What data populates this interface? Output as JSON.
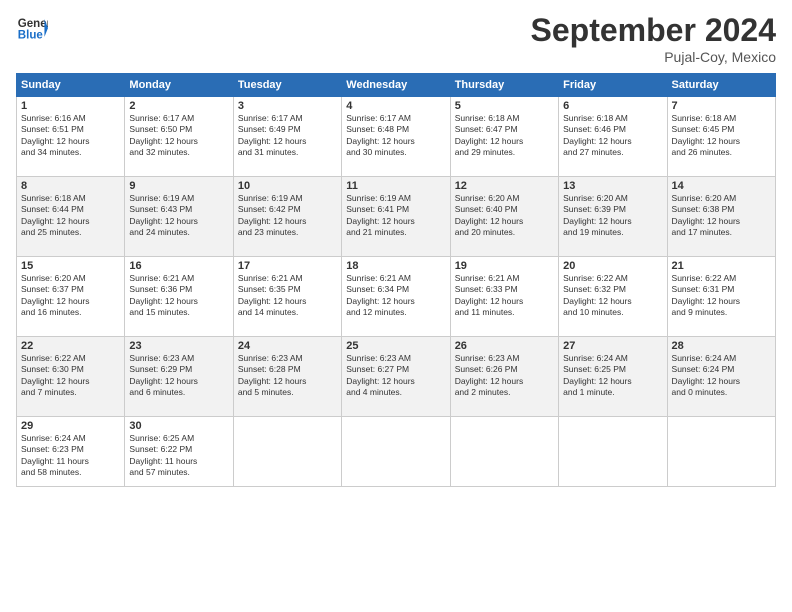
{
  "header": {
    "logo_line1": "General",
    "logo_line2": "Blue",
    "month_title": "September 2024",
    "location": "Pujal-Coy, Mexico"
  },
  "days_of_week": [
    "Sunday",
    "Monday",
    "Tuesday",
    "Wednesday",
    "Thursday",
    "Friday",
    "Saturday"
  ],
  "weeks": [
    [
      {
        "day": "1",
        "content": "Sunrise: 6:16 AM\nSunset: 6:51 PM\nDaylight: 12 hours\nand 34 minutes."
      },
      {
        "day": "2",
        "content": "Sunrise: 6:17 AM\nSunset: 6:50 PM\nDaylight: 12 hours\nand 32 minutes."
      },
      {
        "day": "3",
        "content": "Sunrise: 6:17 AM\nSunset: 6:49 PM\nDaylight: 12 hours\nand 31 minutes."
      },
      {
        "day": "4",
        "content": "Sunrise: 6:17 AM\nSunset: 6:48 PM\nDaylight: 12 hours\nand 30 minutes."
      },
      {
        "day": "5",
        "content": "Sunrise: 6:18 AM\nSunset: 6:47 PM\nDaylight: 12 hours\nand 29 minutes."
      },
      {
        "day": "6",
        "content": "Sunrise: 6:18 AM\nSunset: 6:46 PM\nDaylight: 12 hours\nand 27 minutes."
      },
      {
        "day": "7",
        "content": "Sunrise: 6:18 AM\nSunset: 6:45 PM\nDaylight: 12 hours\nand 26 minutes."
      }
    ],
    [
      {
        "day": "8",
        "content": "Sunrise: 6:18 AM\nSunset: 6:44 PM\nDaylight: 12 hours\nand 25 minutes."
      },
      {
        "day": "9",
        "content": "Sunrise: 6:19 AM\nSunset: 6:43 PM\nDaylight: 12 hours\nand 24 minutes."
      },
      {
        "day": "10",
        "content": "Sunrise: 6:19 AM\nSunset: 6:42 PM\nDaylight: 12 hours\nand 23 minutes."
      },
      {
        "day": "11",
        "content": "Sunrise: 6:19 AM\nSunset: 6:41 PM\nDaylight: 12 hours\nand 21 minutes."
      },
      {
        "day": "12",
        "content": "Sunrise: 6:20 AM\nSunset: 6:40 PM\nDaylight: 12 hours\nand 20 minutes."
      },
      {
        "day": "13",
        "content": "Sunrise: 6:20 AM\nSunset: 6:39 PM\nDaylight: 12 hours\nand 19 minutes."
      },
      {
        "day": "14",
        "content": "Sunrise: 6:20 AM\nSunset: 6:38 PM\nDaylight: 12 hours\nand 17 minutes."
      }
    ],
    [
      {
        "day": "15",
        "content": "Sunrise: 6:20 AM\nSunset: 6:37 PM\nDaylight: 12 hours\nand 16 minutes."
      },
      {
        "day": "16",
        "content": "Sunrise: 6:21 AM\nSunset: 6:36 PM\nDaylight: 12 hours\nand 15 minutes."
      },
      {
        "day": "17",
        "content": "Sunrise: 6:21 AM\nSunset: 6:35 PM\nDaylight: 12 hours\nand 14 minutes."
      },
      {
        "day": "18",
        "content": "Sunrise: 6:21 AM\nSunset: 6:34 PM\nDaylight: 12 hours\nand 12 minutes."
      },
      {
        "day": "19",
        "content": "Sunrise: 6:21 AM\nSunset: 6:33 PM\nDaylight: 12 hours\nand 11 minutes."
      },
      {
        "day": "20",
        "content": "Sunrise: 6:22 AM\nSunset: 6:32 PM\nDaylight: 12 hours\nand 10 minutes."
      },
      {
        "day": "21",
        "content": "Sunrise: 6:22 AM\nSunset: 6:31 PM\nDaylight: 12 hours\nand 9 minutes."
      }
    ],
    [
      {
        "day": "22",
        "content": "Sunrise: 6:22 AM\nSunset: 6:30 PM\nDaylight: 12 hours\nand 7 minutes."
      },
      {
        "day": "23",
        "content": "Sunrise: 6:23 AM\nSunset: 6:29 PM\nDaylight: 12 hours\nand 6 minutes."
      },
      {
        "day": "24",
        "content": "Sunrise: 6:23 AM\nSunset: 6:28 PM\nDaylight: 12 hours\nand 5 minutes."
      },
      {
        "day": "25",
        "content": "Sunrise: 6:23 AM\nSunset: 6:27 PM\nDaylight: 12 hours\nand 4 minutes."
      },
      {
        "day": "26",
        "content": "Sunrise: 6:23 AM\nSunset: 6:26 PM\nDaylight: 12 hours\nand 2 minutes."
      },
      {
        "day": "27",
        "content": "Sunrise: 6:24 AM\nSunset: 6:25 PM\nDaylight: 12 hours\nand 1 minute."
      },
      {
        "day": "28",
        "content": "Sunrise: 6:24 AM\nSunset: 6:24 PM\nDaylight: 12 hours\nand 0 minutes."
      }
    ],
    [
      {
        "day": "29",
        "content": "Sunrise: 6:24 AM\nSunset: 6:23 PM\nDaylight: 11 hours\nand 58 minutes."
      },
      {
        "day": "30",
        "content": "Sunrise: 6:25 AM\nSunset: 6:22 PM\nDaylight: 11 hours\nand 57 minutes."
      },
      {
        "day": "",
        "content": ""
      },
      {
        "day": "",
        "content": ""
      },
      {
        "day": "",
        "content": ""
      },
      {
        "day": "",
        "content": ""
      },
      {
        "day": "",
        "content": ""
      }
    ]
  ]
}
